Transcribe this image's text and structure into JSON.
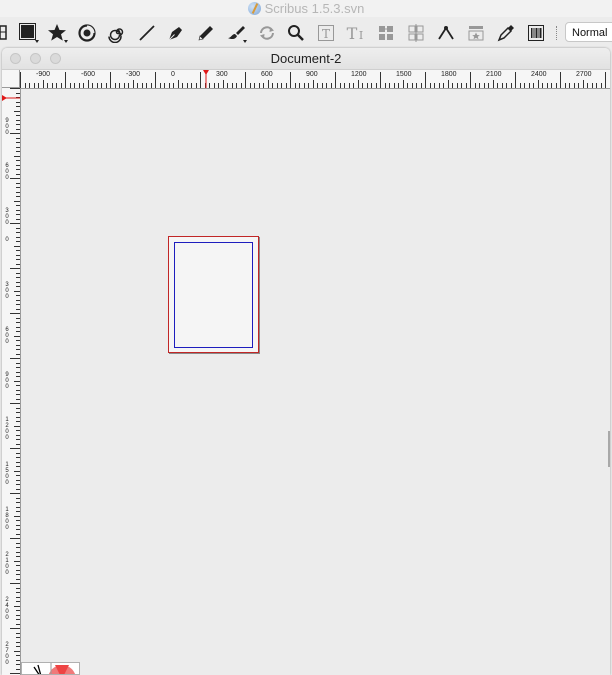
{
  "app": {
    "title": "Scribus 1.5.3.svn",
    "icon": "scribus-logo-icon"
  },
  "toolbar": {
    "tools": [
      {
        "name": "frames-tool",
        "icon": "rectangle-frame-icon"
      },
      {
        "name": "shapes-tool",
        "icon": "star-shape-icon"
      },
      {
        "name": "arc-tool",
        "icon": "arc-icon"
      },
      {
        "name": "spiral-tool",
        "icon": "spiral-icon"
      },
      {
        "name": "line-tool",
        "icon": "line-icon"
      },
      {
        "name": "bezier-tool",
        "icon": "pen-icon"
      },
      {
        "name": "freehand-tool",
        "icon": "pencil-icon"
      },
      {
        "name": "calligraphic-tool",
        "icon": "brush-icon"
      },
      {
        "name": "rotate-tool",
        "icon": "rotate-icon"
      },
      {
        "name": "zoom-tool",
        "icon": "magnifier-icon"
      },
      {
        "name": "edit-text-tool",
        "icon": "text-edit-icon"
      },
      {
        "name": "story-editor-tool",
        "icon": "story-editor-icon"
      },
      {
        "name": "link-frames-tool",
        "icon": "link-frames-icon"
      },
      {
        "name": "unlink-frames-tool",
        "icon": "unlink-frames-icon"
      },
      {
        "name": "measurements-tool",
        "icon": "measure-icon"
      },
      {
        "name": "copy-properties-tool",
        "icon": "copy-properties-icon"
      },
      {
        "name": "eyedropper-tool",
        "icon": "eyedropper-icon"
      },
      {
        "name": "barcode-tool",
        "icon": "barcode-icon"
      }
    ],
    "mode_select": {
      "value": "Normal"
    }
  },
  "document": {
    "title": "Document-2",
    "window_controls": [
      "close-button",
      "minimize-button",
      "zoom-button"
    ],
    "page_border_color": "#c12626",
    "margin_guide_color": "#1d1dbe"
  },
  "rulers": {
    "horizontal_labels": [
      "-900",
      "-600",
      "-300",
      "0",
      "300",
      "600",
      "900",
      "1200",
      "1500",
      "1800",
      "2100",
      "2400",
      "2700"
    ],
    "vertical_labels": [
      "900",
      "600",
      "300",
      "0",
      "300",
      "600",
      "900",
      "1200",
      "1500",
      "1800",
      "2100",
      "2400",
      "2700"
    ],
    "marker_color": "#e01818"
  }
}
